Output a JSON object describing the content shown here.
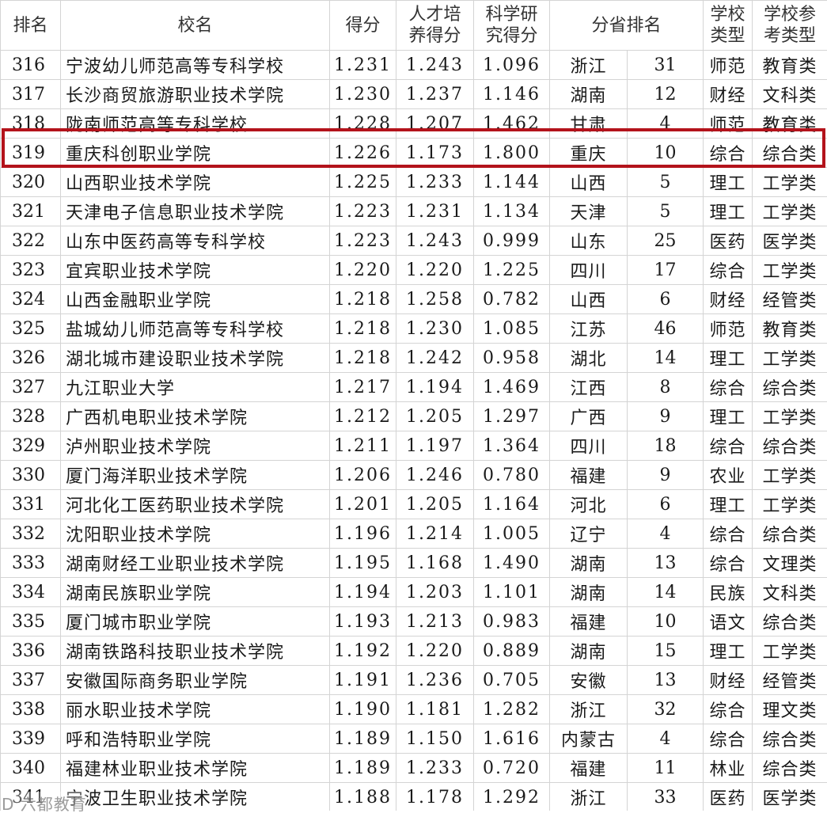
{
  "headers": {
    "rank": "排名",
    "name": "校名",
    "score": "得分",
    "talent_l1": "人才培",
    "talent_l2": "养得分",
    "research_l1": "科学研",
    "research_l2": "究得分",
    "province_rank": "分省排名",
    "type_l1": "学校",
    "type_l2": "类型",
    "reftype_l1": "学校参",
    "reftype_l2": "考类型"
  },
  "highlight_color": "#b3131b",
  "highlight_rank": "319",
  "watermark": "D 六都教育",
  "rows": [
    {
      "rank": "316",
      "name": "宁波幼儿师范高等专科学校",
      "score": "1.231",
      "talent": "1.243",
      "research": "1.096",
      "province": "浙江",
      "prank": "31",
      "type": "师范",
      "reftype": "教育类"
    },
    {
      "rank": "317",
      "name": "长沙商贸旅游职业技术学院",
      "score": "1.230",
      "talent": "1.237",
      "research": "1.146",
      "province": "湖南",
      "prank": "12",
      "type": "财经",
      "reftype": "文科类"
    },
    {
      "rank": "318",
      "name": "陇南师范高等专科学校",
      "score": "1.228",
      "talent": "1.207",
      "research": "1.462",
      "province": "甘肃",
      "prank": "4",
      "type": "师范",
      "reftype": "教育类"
    },
    {
      "rank": "319",
      "name": "重庆科创职业学院",
      "score": "1.226",
      "talent": "1.173",
      "research": "1.800",
      "province": "重庆",
      "prank": "10",
      "type": "综合",
      "reftype": "综合类"
    },
    {
      "rank": "320",
      "name": "山西职业技术学院",
      "score": "1.225",
      "talent": "1.233",
      "research": "1.144",
      "province": "山西",
      "prank": "5",
      "type": "理工",
      "reftype": "工学类"
    },
    {
      "rank": "321",
      "name": "天津电子信息职业技术学院",
      "score": "1.223",
      "talent": "1.231",
      "research": "1.134",
      "province": "天津",
      "prank": "5",
      "type": "理工",
      "reftype": "工学类"
    },
    {
      "rank": "322",
      "name": "山东中医药高等专科学校",
      "score": "1.223",
      "talent": "1.243",
      "research": "0.999",
      "province": "山东",
      "prank": "25",
      "type": "医药",
      "reftype": "医学类"
    },
    {
      "rank": "323",
      "name": "宜宾职业技术学院",
      "score": "1.220",
      "talent": "1.220",
      "research": "1.225",
      "province": "四川",
      "prank": "17",
      "type": "综合",
      "reftype": "工学类"
    },
    {
      "rank": "324",
      "name": "山西金融职业学院",
      "score": "1.218",
      "talent": "1.258",
      "research": "0.782",
      "province": "山西",
      "prank": "6",
      "type": "财经",
      "reftype": "经管类"
    },
    {
      "rank": "325",
      "name": "盐城幼儿师范高等专科学校",
      "score": "1.218",
      "talent": "1.230",
      "research": "1.085",
      "province": "江苏",
      "prank": "46",
      "type": "师范",
      "reftype": "教育类"
    },
    {
      "rank": "326",
      "name": "湖北城市建设职业技术学院",
      "score": "1.218",
      "talent": "1.242",
      "research": "0.958",
      "province": "湖北",
      "prank": "14",
      "type": "理工",
      "reftype": "工学类"
    },
    {
      "rank": "327",
      "name": "九江职业大学",
      "score": "1.217",
      "talent": "1.194",
      "research": "1.469",
      "province": "江西",
      "prank": "8",
      "type": "综合",
      "reftype": "综合类"
    },
    {
      "rank": "328",
      "name": "广西机电职业技术学院",
      "score": "1.212",
      "talent": "1.205",
      "research": "1.297",
      "province": "广西",
      "prank": "9",
      "type": "理工",
      "reftype": "工学类"
    },
    {
      "rank": "329",
      "name": "泸州职业技术学院",
      "score": "1.211",
      "talent": "1.197",
      "research": "1.364",
      "province": "四川",
      "prank": "18",
      "type": "综合",
      "reftype": "综合类"
    },
    {
      "rank": "330",
      "name": "厦门海洋职业技术学院",
      "score": "1.206",
      "talent": "1.246",
      "research": "0.780",
      "province": "福建",
      "prank": "9",
      "type": "农业",
      "reftype": "工学类"
    },
    {
      "rank": "331",
      "name": "河北化工医药职业技术学院",
      "score": "1.201",
      "talent": "1.205",
      "research": "1.164",
      "province": "河北",
      "prank": "6",
      "type": "理工",
      "reftype": "工学类"
    },
    {
      "rank": "332",
      "name": "沈阳职业技术学院",
      "score": "1.196",
      "talent": "1.214",
      "research": "1.005",
      "province": "辽宁",
      "prank": "4",
      "type": "综合",
      "reftype": "综合类"
    },
    {
      "rank": "333",
      "name": "湖南财经工业职业技术学院",
      "score": "1.195",
      "talent": "1.168",
      "research": "1.490",
      "province": "湖南",
      "prank": "13",
      "type": "综合",
      "reftype": "文理类"
    },
    {
      "rank": "334",
      "name": "湖南民族职业学院",
      "score": "1.194",
      "talent": "1.203",
      "research": "1.101",
      "province": "湖南",
      "prank": "14",
      "type": "民族",
      "reftype": "文科类"
    },
    {
      "rank": "335",
      "name": "厦门城市职业学院",
      "score": "1.193",
      "talent": "1.213",
      "research": "0.983",
      "province": "福建",
      "prank": "10",
      "type": "语文",
      "reftype": "综合类"
    },
    {
      "rank": "336",
      "name": "湖南铁路科技职业技术学院",
      "score": "1.192",
      "talent": "1.220",
      "research": "0.889",
      "province": "湖南",
      "prank": "15",
      "type": "理工",
      "reftype": "工学类"
    },
    {
      "rank": "337",
      "name": "安徽国际商务职业学院",
      "score": "1.191",
      "talent": "1.236",
      "research": "0.705",
      "province": "安徽",
      "prank": "13",
      "type": "财经",
      "reftype": "经管类"
    },
    {
      "rank": "338",
      "name": "丽水职业技术学院",
      "score": "1.190",
      "talent": "1.181",
      "research": "1.282",
      "province": "浙江",
      "prank": "32",
      "type": "综合",
      "reftype": "理文类"
    },
    {
      "rank": "339",
      "name": "呼和浩特职业学院",
      "score": "1.189",
      "talent": "1.150",
      "research": "1.616",
      "province": "内蒙古",
      "prank": "4",
      "type": "综合",
      "reftype": "综合类"
    },
    {
      "rank": "340",
      "name": "福建林业职业技术学院",
      "score": "1.189",
      "talent": "1.233",
      "research": "0.720",
      "province": "福建",
      "prank": "11",
      "type": "林业",
      "reftype": "综合类"
    },
    {
      "rank": "341",
      "name": "宁波卫生职业技术学院",
      "score": "1.188",
      "talent": "1.178",
      "research": "1.292",
      "province": "浙江",
      "prank": "33",
      "type": "医药",
      "reftype": "医学类"
    }
  ]
}
